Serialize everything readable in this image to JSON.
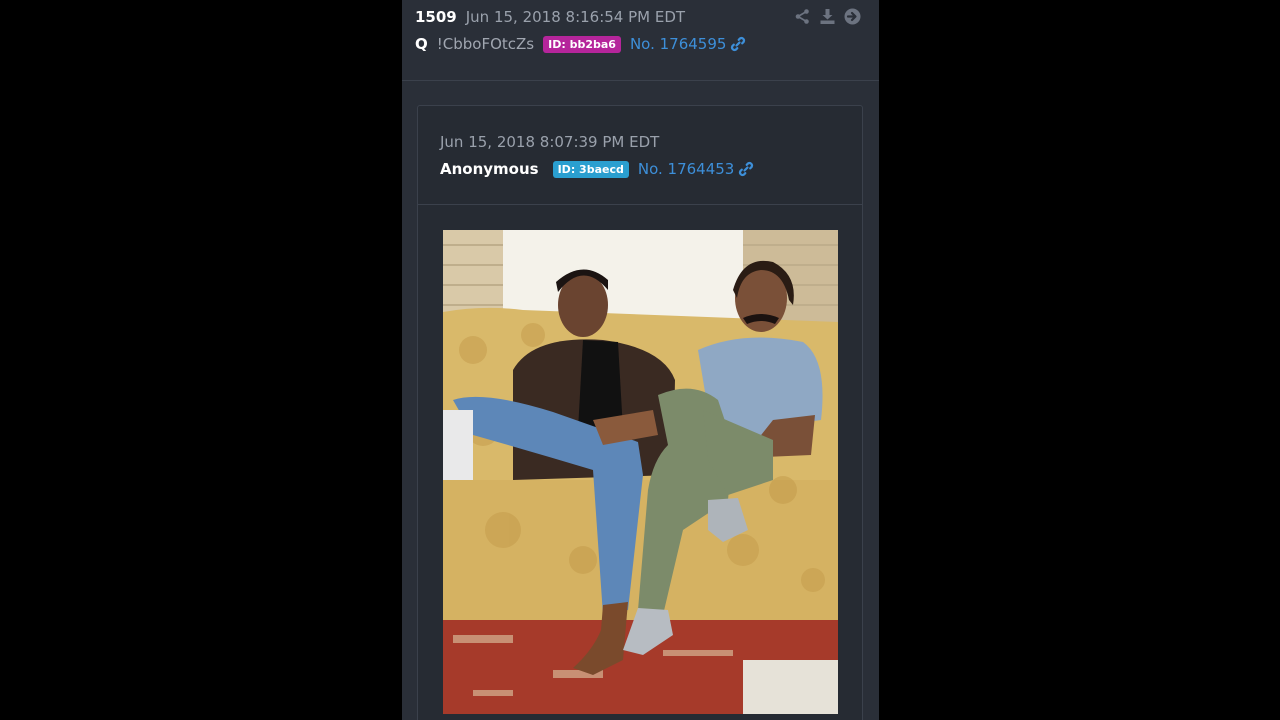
{
  "post": {
    "number": "1509",
    "date": "Jun 15, 2018 8:16:54 PM EDT",
    "author": "Q",
    "tripcode": "!CbboFOtcZs",
    "id_badge": "ID: bb2ba6",
    "id_color": "#b5259b",
    "post_ref": "No. 1764595",
    "actions": [
      "share-icon",
      "download-icon",
      "arrow-right-circle-icon"
    ]
  },
  "quoted": {
    "date": "Jun 15, 2018 8:07:39 PM EDT",
    "author": "Anonymous",
    "id_badge": "ID: 3baecd",
    "id_color": "#2a9fd0",
    "post_ref": "No. 1764453"
  },
  "colors": {
    "panel_bg": "#2a2f38",
    "link": "#3d8fd9"
  }
}
